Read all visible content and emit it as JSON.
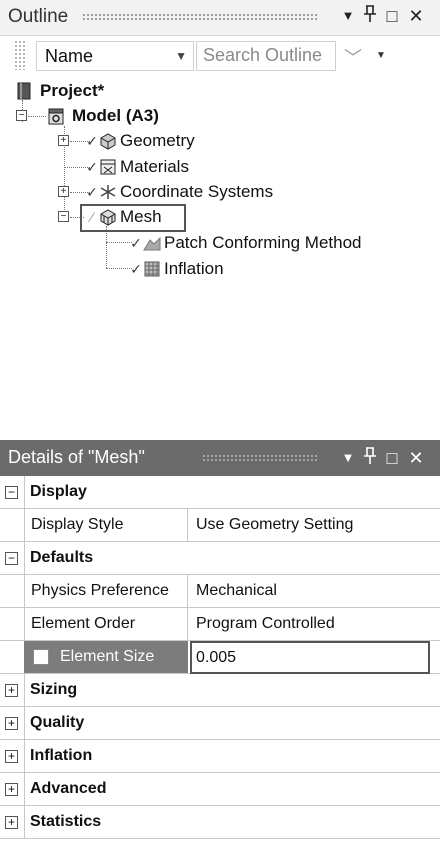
{
  "outline": {
    "title": "Outline",
    "buttons": {
      "dropdown": "▼",
      "pin": "ᑭ",
      "maximize": "□",
      "close": "✕"
    },
    "toolbar": {
      "name_select_value": "Name",
      "search_placeholder": "Search Outline",
      "search_chevron": "﹀",
      "search_drop": "▼"
    },
    "tree": {
      "project": "Project*",
      "model": "Model (A3)",
      "geometry": "Geometry",
      "materials": "Materials",
      "coordinate_systems": "Coordinate Systems",
      "mesh": "Mesh",
      "patch_conforming": "Patch Conforming Method",
      "inflation": "Inflation"
    }
  },
  "details": {
    "title": "Details of \"Mesh\"",
    "buttons": {
      "dropdown": "▼",
      "pin": "ᑭ",
      "maximize": "□",
      "close": "✕"
    },
    "categories": {
      "display": "Display",
      "defaults": "Defaults",
      "sizing": "Sizing",
      "quality": "Quality",
      "inflation": "Inflation",
      "advanced": "Advanced",
      "statistics": "Statistics"
    },
    "rows": {
      "display_style_key": "Display Style",
      "display_style_val": "Use Geometry Setting",
      "physics_key": "Physics Preference",
      "physics_val": "Mechanical",
      "element_order_key": "Element Order",
      "element_order_val": "Program Controlled",
      "element_size_key": "Element Size",
      "element_size_val": "0.005"
    },
    "toggles": {
      "collapse": "−",
      "expand": "+"
    }
  }
}
